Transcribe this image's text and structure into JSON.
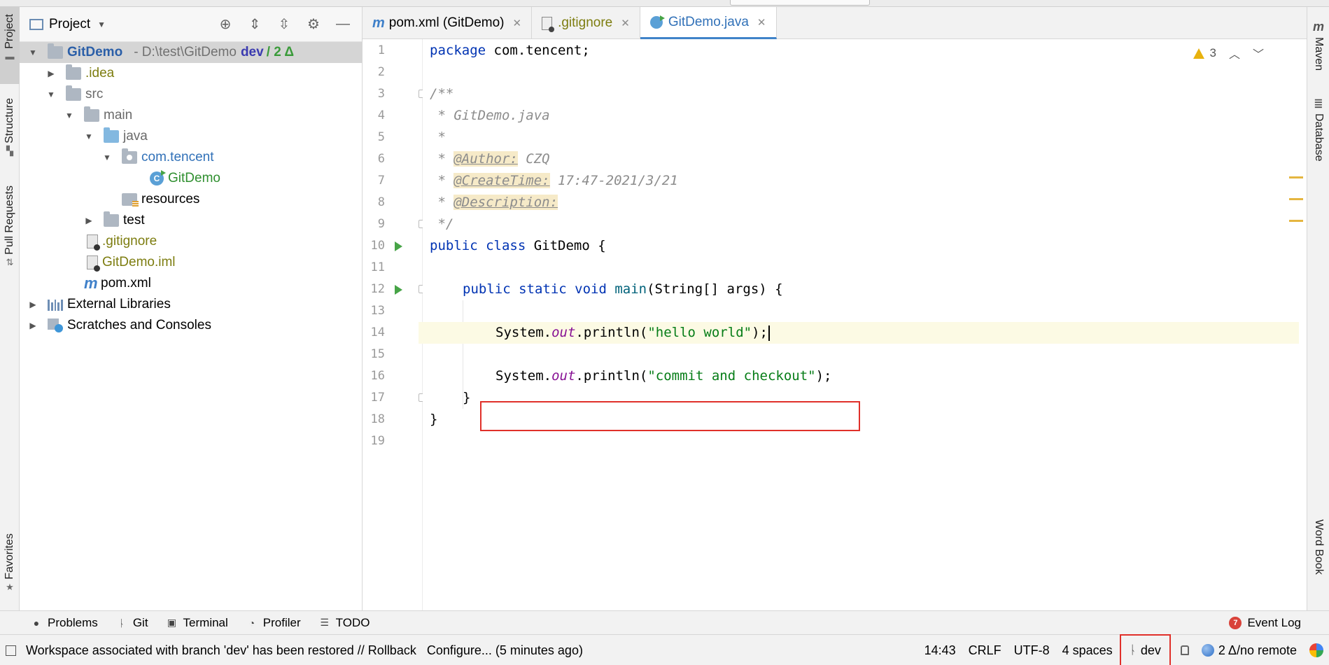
{
  "project_panel": {
    "title": "Project",
    "tree": [
      {
        "label": "GitDemo",
        "path": "- D:\\test\\GitDemo",
        "branch": "dev",
        "changes": "/ 2 Δ"
      },
      {
        "label": ".idea"
      },
      {
        "label": "src"
      },
      {
        "label": "main"
      },
      {
        "label": "java"
      },
      {
        "label": "com.tencent"
      },
      {
        "label": "GitDemo"
      },
      {
        "label": "resources"
      },
      {
        "label": "test"
      },
      {
        "label": ".gitignore"
      },
      {
        "label": "GitDemo.iml"
      },
      {
        "label": "pom.xml"
      },
      {
        "label": "External Libraries"
      },
      {
        "label": "Scratches and Consoles"
      }
    ]
  },
  "left_tabs": [
    "Project",
    "Structure",
    "Pull Requests",
    "Favorites"
  ],
  "right_tabs": [
    "Maven",
    "Database",
    "Word Book"
  ],
  "editor": {
    "tabs": [
      {
        "label": "pom.xml (GitDemo)"
      },
      {
        "label": ".gitignore"
      },
      {
        "label": "GitDemo.java"
      }
    ],
    "warnings_count": "3",
    "line_numbers": [
      "1",
      "2",
      "3",
      "4",
      "5",
      "6",
      "7",
      "8",
      "9",
      "10",
      "11",
      "12",
      "13",
      "14",
      "15",
      "16",
      "17",
      "18",
      "19"
    ],
    "code": {
      "l1_kw": "package",
      "l1_rest": " com.tencent;",
      "l3": "/**",
      "l4": " * GitDemo.java",
      "l5": " *",
      "l6_pre": " * ",
      "l6_tag": "@Author:",
      "l6_val": " CZQ",
      "l7_pre": " * ",
      "l7_tag": "@CreateTime:",
      "l7_val": " 17:47-2021/3/21",
      "l8_pre": " * ",
      "l8_tag": "@Description:",
      "l9": " */",
      "l10_kw": "public class",
      "l10_rest": " GitDemo {",
      "l12_kw": "public static void",
      "l12_method": " main",
      "l12_rest": "(String[] args) {",
      "l14_obj": "System.",
      "l14_field": "out",
      "l14_call": ".println(",
      "l14_str": "\"hello world\"",
      "l14_end": ");",
      "l16_obj": "System.",
      "l16_field": "out",
      "l16_call": ".println(",
      "l16_str": "\"commit and checkout\"",
      "l16_end": ");",
      "l17": "}",
      "l18": "}"
    }
  },
  "tool_windows": {
    "items": [
      "Problems",
      "Git",
      "Terminal",
      "Profiler",
      "TODO"
    ],
    "event_log": "Event Log",
    "event_count": "7"
  },
  "status_bar": {
    "message": "Workspace associated with branch 'dev' has been restored // Rollback   Configure... (5 minutes ago)",
    "position": "14:43",
    "line_sep": "CRLF",
    "encoding": "UTF-8",
    "indent": "4 spaces",
    "branch": "dev",
    "remote": "2 Δ/no remote"
  }
}
